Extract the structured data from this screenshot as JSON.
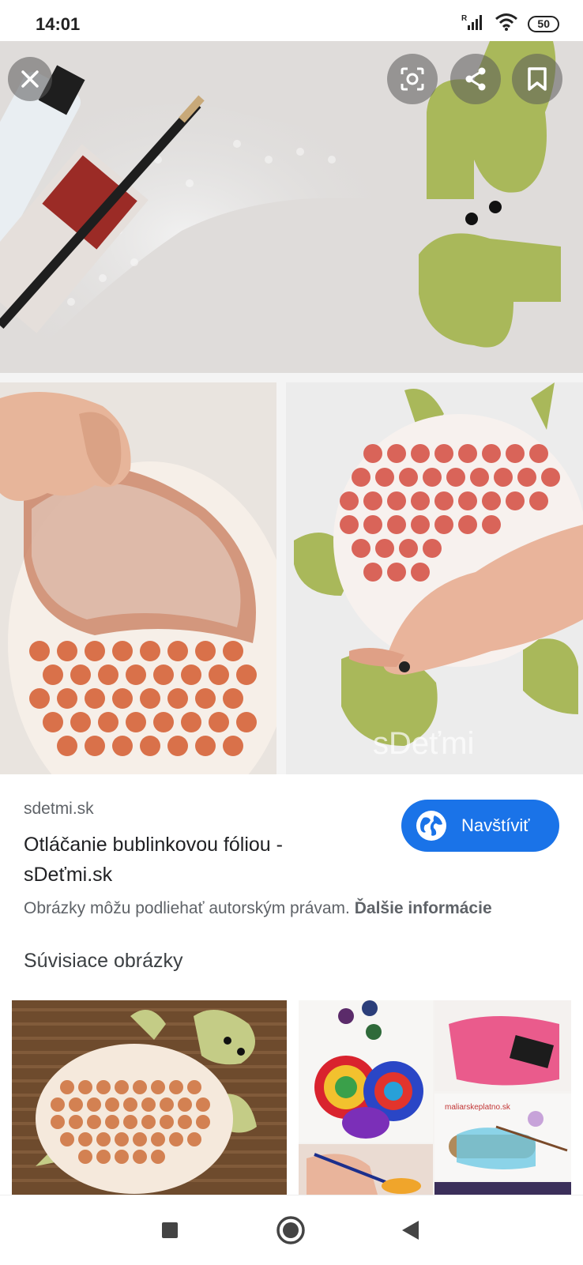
{
  "status_bar": {
    "time": "14:01",
    "signal_indicator": "R",
    "battery": "50",
    "icons": [
      "signal-icon",
      "wifi-icon",
      "battery-icon"
    ]
  },
  "image_viewer": {
    "icons": [
      "close-icon",
      "lens-icon",
      "share-icon",
      "bookmark-icon"
    ],
    "watermark": "sDeťmi"
  },
  "result": {
    "source": "sdetmi.sk",
    "title": "Otláčanie bublinkovou fóliou - sDeťmi.sk",
    "visit_label": "Navštíviť",
    "copyright_text": "Obrázky môžu podliehať autorským právam.",
    "more_info_link": "Ďalšie informácie"
  },
  "related": {
    "heading": "Súvisiace obrázky",
    "thumb2_watermark": "maliarskeplatno.sk"
  },
  "nav": {
    "icons": [
      "recent-apps-icon",
      "home-icon",
      "back-icon"
    ]
  },
  "colors": {
    "accent": "#1a73e8",
    "turtle_green": "#a9b85a",
    "bubble_orange": "#d9714a"
  }
}
